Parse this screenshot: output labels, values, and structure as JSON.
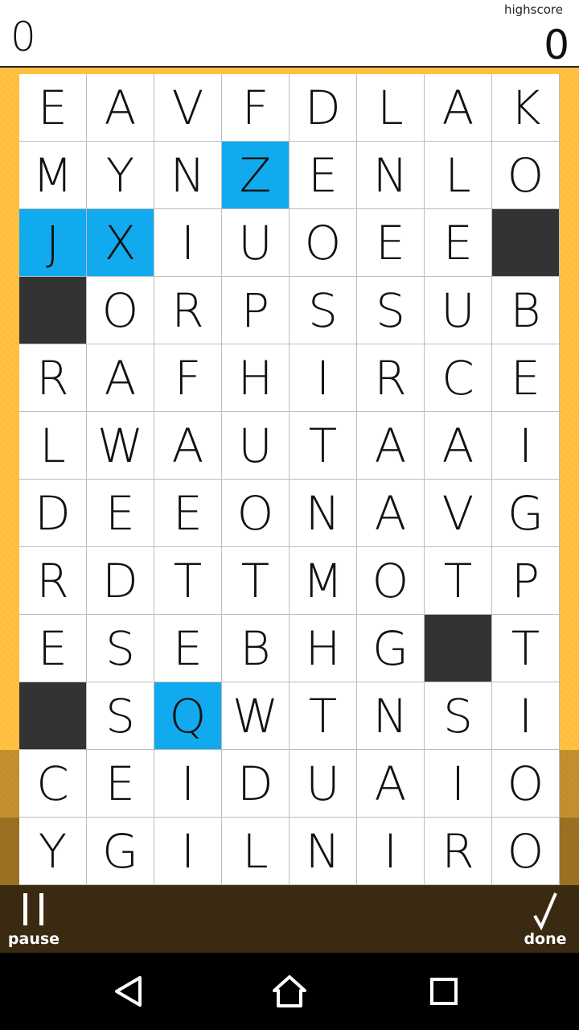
{
  "header": {
    "score": "0",
    "highscore_label": "highscore",
    "highscore": "0"
  },
  "grid": {
    "rows": [
      [
        "E",
        "A",
        "V",
        "F",
        "D",
        "L",
        "A",
        "K"
      ],
      [
        "M",
        "Y",
        "N",
        "Z",
        "E",
        "N",
        "L",
        "O"
      ],
      [
        "J",
        "X",
        "I",
        "U",
        "O",
        "E",
        "E",
        ""
      ],
      [
        "",
        "O",
        "R",
        "P",
        "S",
        "S",
        "U",
        "B"
      ],
      [
        "R",
        "A",
        "F",
        "H",
        "I",
        "R",
        "C",
        "E"
      ],
      [
        "L",
        "W",
        "A",
        "U",
        "T",
        "A",
        "A",
        "I"
      ],
      [
        "D",
        "E",
        "E",
        "O",
        "N",
        "A",
        "V",
        "G"
      ],
      [
        "R",
        "D",
        "T",
        "T",
        "M",
        "O",
        "T",
        "P"
      ],
      [
        "E",
        "S",
        "E",
        "B",
        "H",
        "G",
        "",
        "T"
      ],
      [
        "",
        "S",
        "Q",
        "W",
        "T",
        "N",
        "S",
        "I"
      ],
      [
        "C",
        "E",
        "I",
        "D",
        "U",
        "A",
        "I",
        "O"
      ],
      [
        "Y",
        "G",
        "I",
        "L",
        "N",
        "I",
        "R",
        "O"
      ]
    ],
    "highlighted_cells": [
      [
        1,
        3
      ],
      [
        2,
        0
      ],
      [
        2,
        1
      ],
      [
        9,
        2
      ]
    ],
    "blocked_cells": [
      [
        2,
        7
      ],
      [
        3,
        0
      ],
      [
        8,
        6
      ],
      [
        9,
        0
      ]
    ],
    "colors": {
      "highlight": "#12aaee",
      "blocked": "#333333",
      "background": "#ffbd3c"
    }
  },
  "controls": {
    "pause_label": "pause",
    "pause_icon": "pause-icon",
    "done_label": "done",
    "done_icon": "check-icon"
  },
  "navbar": {
    "icons": [
      "back-icon",
      "home-icon",
      "recents-icon"
    ]
  }
}
